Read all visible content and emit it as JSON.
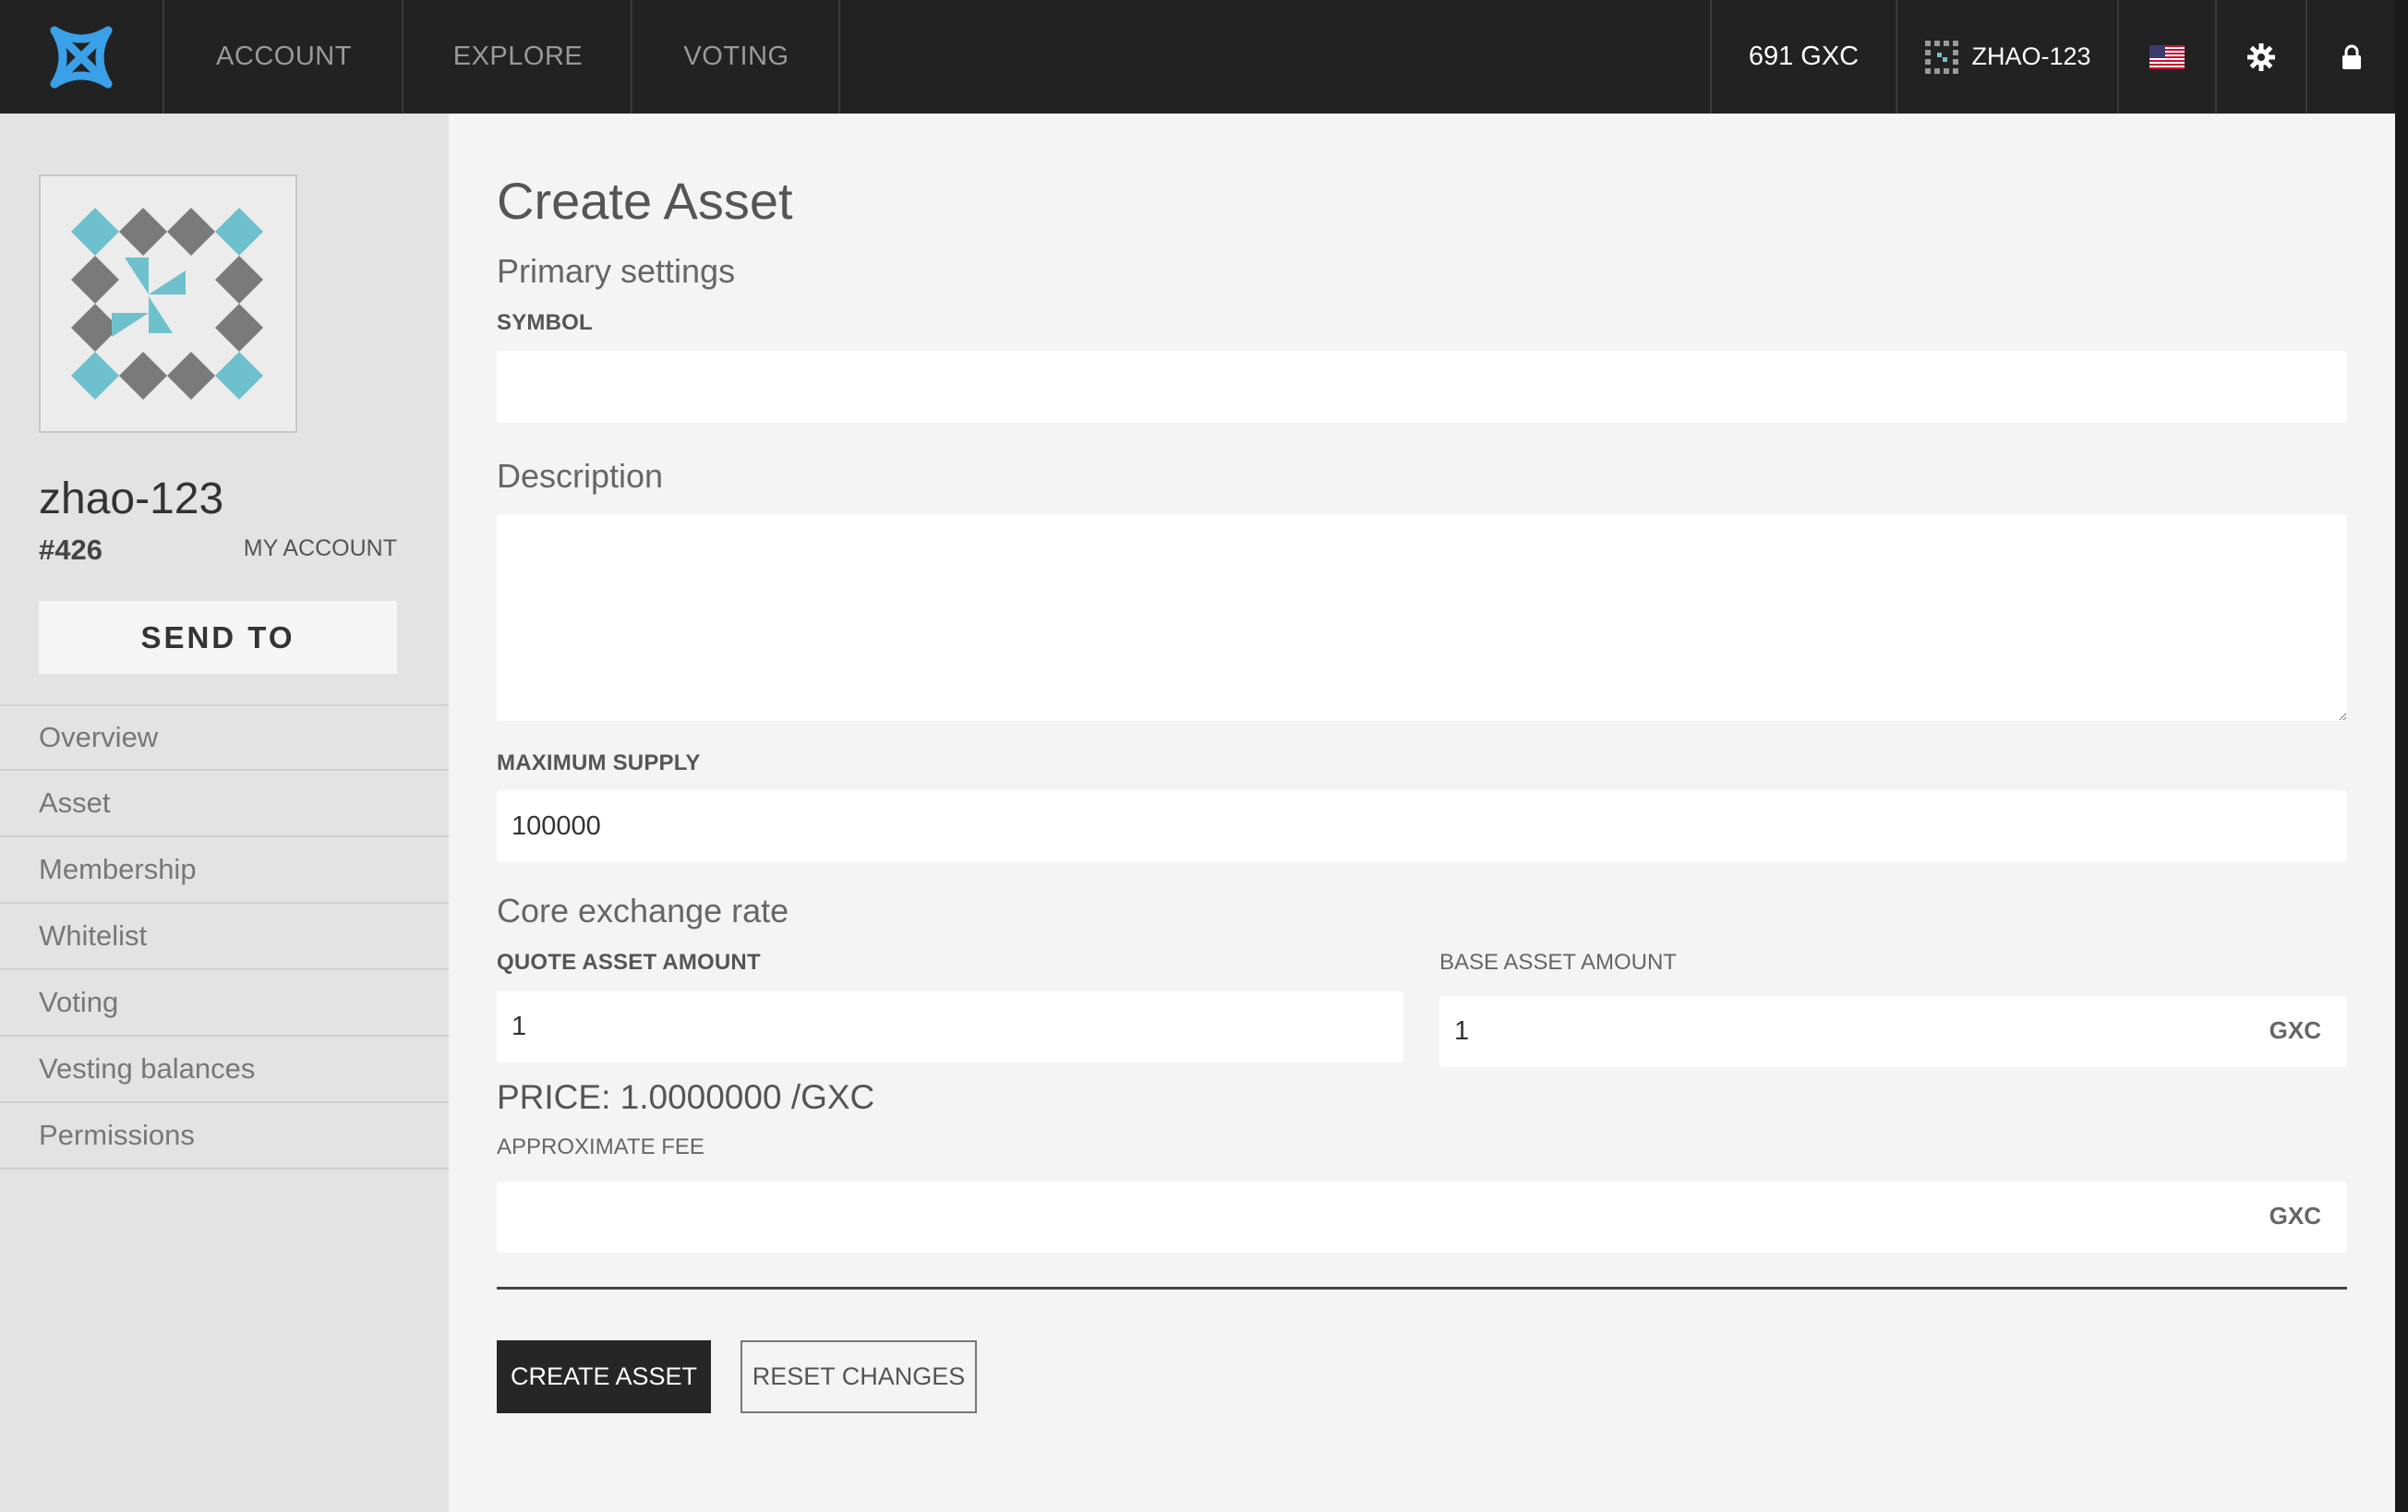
{
  "nav": {
    "items": [
      "ACCOUNT",
      "EXPLORE",
      "VOTING"
    ],
    "balance": "691 GXC",
    "account": "ZHAO-123",
    "flag_icon": "us-flag-icon",
    "settings_icon": "gear-icon",
    "lock_icon": "lock-icon",
    "logo_color": "#3aa0e8"
  },
  "sidebar": {
    "account_name": "zhao-123",
    "account_id": "#426",
    "my_account_label": "MY ACCOUNT",
    "send_to_label": "SEND TO",
    "menu": [
      "Overview",
      "Asset",
      "Membership",
      "Whitelist",
      "Voting",
      "Vesting balances",
      "Permissions"
    ],
    "avatar_colors": [
      "#6ec1cc",
      "#7a7a7a"
    ]
  },
  "form": {
    "title": "Create Asset",
    "primary_settings": "Primary settings",
    "symbol_label": "SYMBOL",
    "symbol_value": "",
    "description_label": "Description",
    "description_value": "",
    "max_supply_label": "MAXIMUM SUPPLY",
    "max_supply_value": "100000",
    "core_exchange_rate": "Core exchange rate",
    "quote_label": "QUOTE ASSET AMOUNT",
    "quote_value": "1",
    "base_label": "BASE ASSET AMOUNT",
    "base_value": "1",
    "base_unit": "GXC",
    "price_text": "PRICE: 1.0000000 /GXC",
    "fee_label": "APPROXIMATE FEE",
    "fee_value": "",
    "fee_unit": "GXC",
    "create_button": "CREATE ASSET",
    "reset_button": "RESET CHANGES"
  }
}
